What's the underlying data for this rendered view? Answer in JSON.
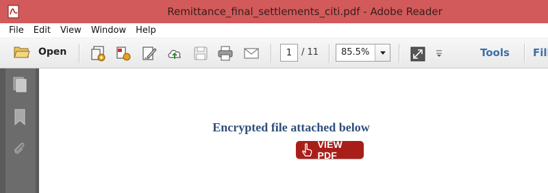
{
  "window": {
    "title": "Remittance_final_settlements_citi.pdf - Adobe Reader",
    "titlebar_color": "#d25a5a"
  },
  "menu": {
    "items": [
      "File",
      "Edit",
      "View",
      "Window",
      "Help"
    ]
  },
  "toolbar": {
    "open_label": "Open",
    "current_page": "1",
    "page_total": "/ 11",
    "zoom": "85.5%",
    "tools_label": "Tools",
    "fill_label": "Fill",
    "icons": [
      "folder-open-icon",
      "create-pdf-icon",
      "combine-files-icon",
      "sign-icon",
      "upload-cloud-icon",
      "save-icon",
      "print-icon",
      "email-icon",
      "full-screen-icon",
      "more-icon"
    ]
  },
  "navpane": {
    "icons": [
      "pages-icon",
      "bookmark-icon",
      "attachment-icon"
    ]
  },
  "document": {
    "heading": "Encrypted file attached below",
    "button_label": "VIEW PDF",
    "button_color": "#a81f1a"
  }
}
